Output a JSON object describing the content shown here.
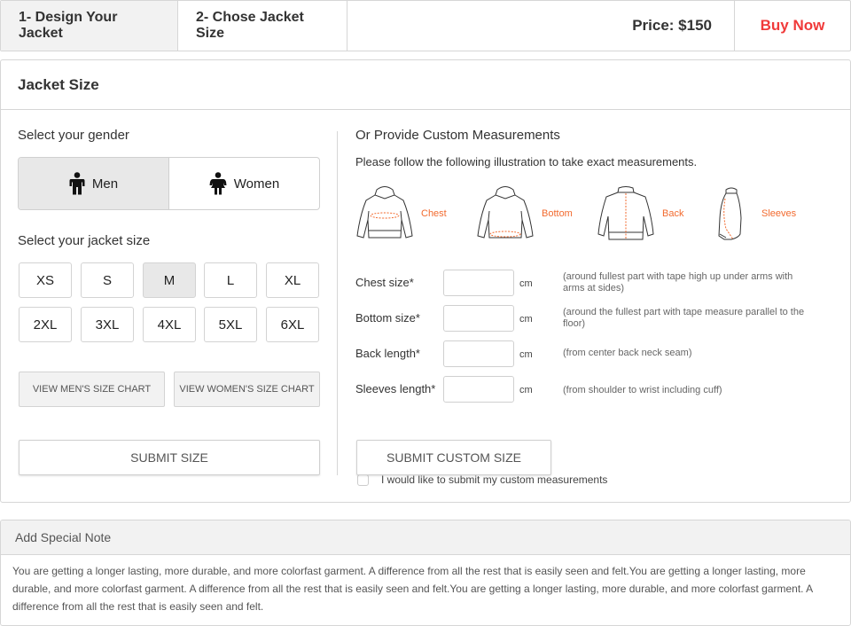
{
  "stepbar": {
    "steps": [
      {
        "label": "1- Design Your Jacket",
        "active": true
      },
      {
        "label": "2- Chose Jacket Size",
        "active": false
      }
    ],
    "price_label": "Price: $150",
    "buy_label": "Buy Now",
    "buy_color": "#f03a3a"
  },
  "jacket_panel": {
    "title": "Jacket Size",
    "gender": {
      "label": "Select your gender",
      "options": [
        {
          "label": "Men",
          "icon": "male-icon",
          "selected": true
        },
        {
          "label": "Women",
          "icon": "female-icon",
          "selected": false
        }
      ]
    },
    "size": {
      "label": "Select your jacket size",
      "options": [
        "XS",
        "S",
        "M",
        "L",
        "XL",
        "2XL",
        "3XL",
        "4XL",
        "5XL",
        "6XL"
      ],
      "selected": "M"
    },
    "chart_buttons": [
      "VIEW MEN'S SIZE CHART",
      "VIEW WOMEN'S SIZE CHART"
    ],
    "submit_label": "SUBMIT SIZE",
    "custom": {
      "title": "Or Provide Custom Measurements",
      "instruction": "Please follow the following illustration to take exact measurements.",
      "illustrations": [
        {
          "label": "Chest",
          "icon": "hoodie-chest-icon"
        },
        {
          "label": "Bottom",
          "icon": "hoodie-bottom-icon"
        },
        {
          "label": "Back",
          "icon": "jacket-back-icon"
        },
        {
          "label": "Sleeves",
          "icon": "jacket-sleeve-icon"
        }
      ],
      "accent_color": "#f26a2e",
      "fields": [
        {
          "label": "Chest size*",
          "value": "",
          "unit": "cm",
          "hint": "(around fullest part with tape high up under arms with arms at sides)"
        },
        {
          "label": "Bottom size*",
          "value": "",
          "unit": "cm",
          "hint": "(around the fullest part with tape measure parallel to the floor)"
        },
        {
          "label": "Back length*",
          "value": "",
          "unit": "cm",
          "hint": "(from center back neck seam)"
        },
        {
          "label": "Sleeves length*",
          "value": "",
          "unit": "cm",
          "hint": "(from shoulder to wrist including cuff)"
        }
      ],
      "checkbox_label": "I would like to submit my custom measurements",
      "checkbox_checked": false,
      "submit_label": "SUBMIT CUSTOM SIZE"
    }
  },
  "note": {
    "title": "Add Special Note",
    "text": "You are getting a longer lasting, more durable, and more colorfast garment. A difference from all the rest that is easily seen and felt.You are getting a longer lasting, more durable, and more colorfast garment. A difference from all the rest that is easily seen and felt.You are getting a longer lasting, more durable, and more colorfast garment. A difference from all the rest that is easily seen and felt."
  }
}
